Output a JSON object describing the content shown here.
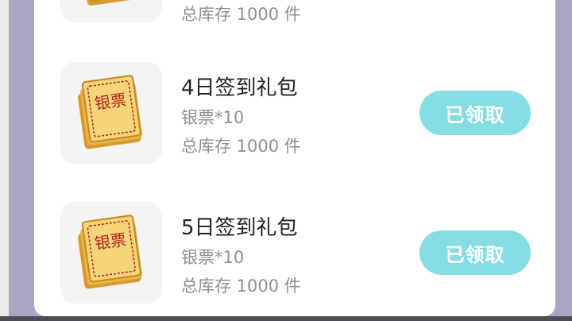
{
  "prev_item": {
    "stock": "总库存 1000 件"
  },
  "gifts": [
    {
      "title": "4日签到礼包",
      "reward": "银票*10",
      "stock": "总库存 1000 件",
      "button": "已领取",
      "ticket_text": "银票"
    },
    {
      "title": "5日签到礼包",
      "reward": "银票*10",
      "stock": "总库存 1000 件",
      "button": "已领取",
      "ticket_text": "银票"
    }
  ],
  "colors": {
    "button_bg": "#86dde4",
    "title": "#222222",
    "subtext": "#8f8f8f",
    "ticket_gold": "#e9b84c",
    "ticket_red": "#b3261e"
  }
}
